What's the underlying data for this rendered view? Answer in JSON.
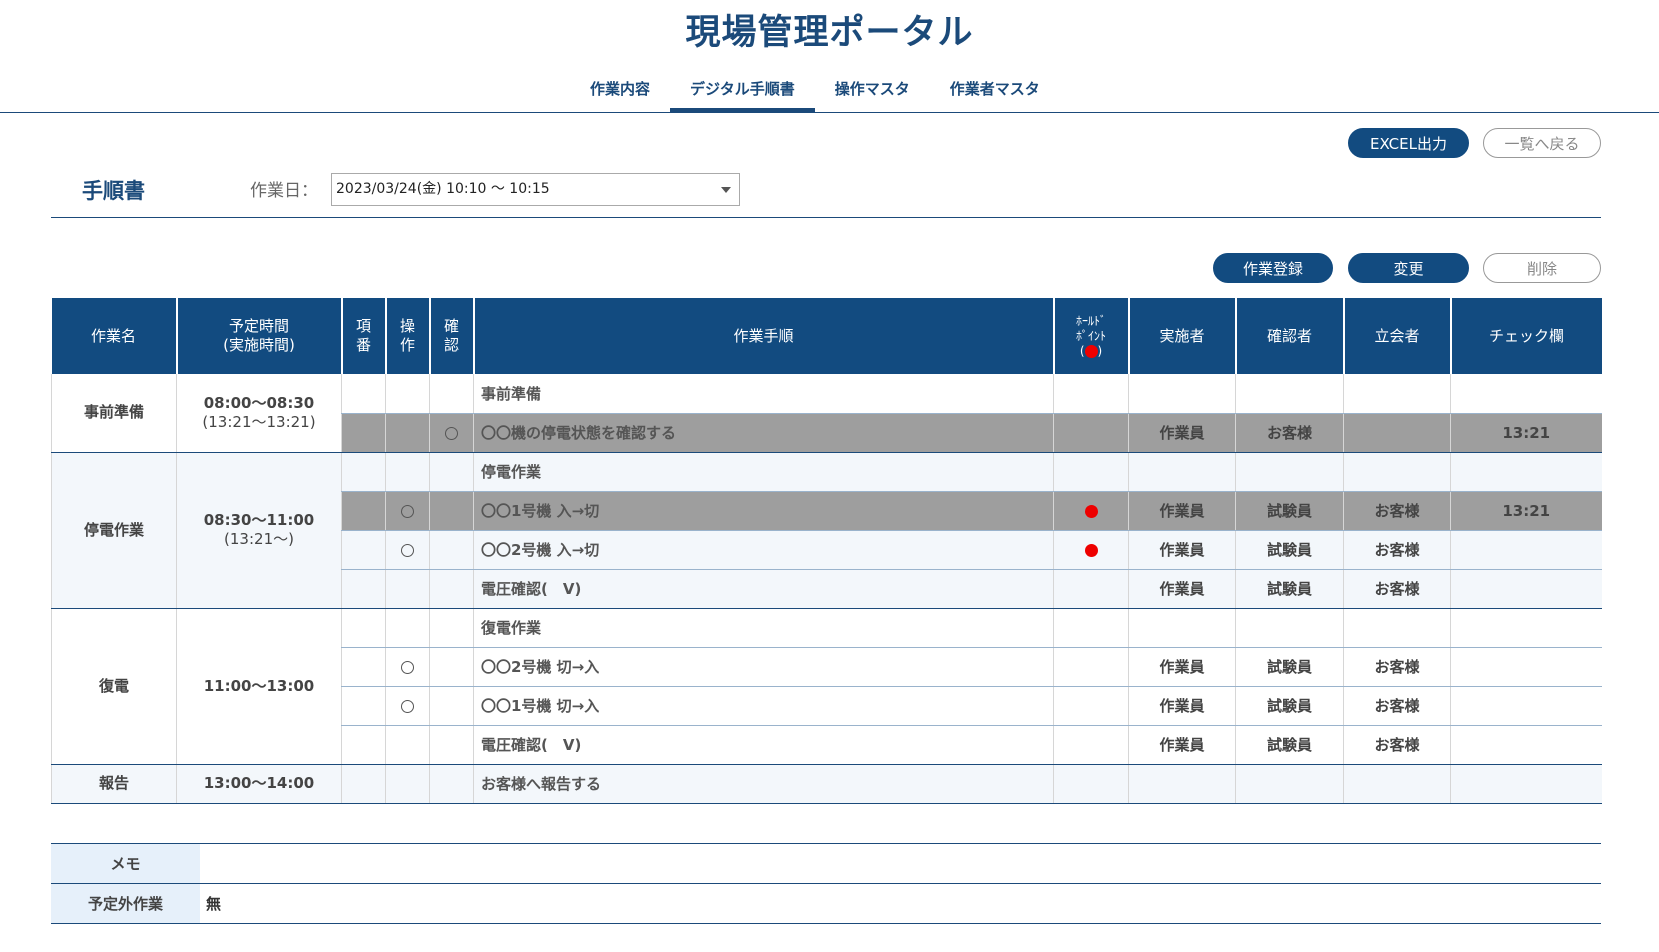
{
  "app": {
    "title": "現場管理ポータル"
  },
  "nav": {
    "tabs": [
      {
        "label": "作業内容",
        "active": false
      },
      {
        "label": "デジタル手順書",
        "active": true
      },
      {
        "label": "操作マスタ",
        "active": false
      },
      {
        "label": "作業者マスタ",
        "active": false
      }
    ]
  },
  "toolbar": {
    "excel_label": "EXCEL出力",
    "back_label": "一覧へ戻る"
  },
  "header": {
    "section_title": "手順書",
    "date_label": "作業日：",
    "date_value": "2023/03/24(金) 10:10 〜 10:15"
  },
  "actions": {
    "register_label": "作業登録",
    "change_label": "変更",
    "delete_label": "削除"
  },
  "table": {
    "headers": {
      "task_name": "作業名",
      "schedule_1": "予定時間",
      "schedule_2": "(実施時間)",
      "item_1": "項",
      "item_2": "番",
      "op_1": "操",
      "op_2": "作",
      "confirm_1": "確",
      "confirm_2": "認",
      "procedure": "作業手順",
      "hold_1": "ﾎｰﾙﾄﾞ",
      "hold_2": "ﾎﾟｲﾝﾄ",
      "hold_3_open": "(",
      "hold_3_close": ")",
      "performer": "実施者",
      "checker": "確認者",
      "witness": "立会者",
      "check_col": "チェック欄"
    },
    "groups": [
      {
        "name": "事前準備",
        "time": "08:00〜08:30",
        "actual": "(13:21〜13:21)",
        "rows": [
          {
            "step": "事前準備",
            "op": false,
            "confirm": false,
            "hold": false,
            "performer": "",
            "checker": "",
            "witness": "",
            "check": "",
            "grey": false
          },
          {
            "step": "〇〇機の停電状態を確認する",
            "op": false,
            "confirm": true,
            "hold": false,
            "performer": "作業員",
            "checker": "お客様",
            "witness": "",
            "check": "13:21",
            "grey": true
          }
        ]
      },
      {
        "name": "停電作業",
        "time": "08:30〜11:00",
        "actual": "(13:21〜)",
        "rows": [
          {
            "step": "停電作業",
            "op": false,
            "confirm": false,
            "hold": false,
            "performer": "",
            "checker": "",
            "witness": "",
            "check": "",
            "grey": false
          },
          {
            "step": "〇〇1号機 入→切",
            "op": true,
            "confirm": false,
            "hold": true,
            "performer": "作業員",
            "checker": "試験員",
            "witness": "お客様",
            "check": "13:21",
            "grey": true
          },
          {
            "step": "〇〇2号機 入→切",
            "op": true,
            "confirm": false,
            "hold": true,
            "performer": "作業員",
            "checker": "試験員",
            "witness": "お客様",
            "check": "",
            "grey": false
          },
          {
            "step": "電圧確認(　V)",
            "op": false,
            "confirm": false,
            "hold": false,
            "performer": "作業員",
            "checker": "試験員",
            "witness": "お客様",
            "check": "",
            "grey": false
          }
        ]
      },
      {
        "name": "復電",
        "time": "11:00〜13:00",
        "actual": "",
        "rows": [
          {
            "step": "復電作業",
            "op": false,
            "confirm": false,
            "hold": false,
            "performer": "",
            "checker": "",
            "witness": "",
            "check": "",
            "grey": false
          },
          {
            "step": "〇〇2号機 切→入",
            "op": true,
            "confirm": false,
            "hold": false,
            "performer": "作業員",
            "checker": "試験員",
            "witness": "お客様",
            "check": "",
            "grey": false
          },
          {
            "step": "〇〇1号機 切→入",
            "op": true,
            "confirm": false,
            "hold": false,
            "performer": "作業員",
            "checker": "試験員",
            "witness": "お客様",
            "check": "",
            "grey": false
          },
          {
            "step": "電圧確認(　V)",
            "op": false,
            "confirm": false,
            "hold": false,
            "performer": "作業員",
            "checker": "試験員",
            "witness": "お客様",
            "check": "",
            "grey": false
          }
        ]
      },
      {
        "name": "報告",
        "time": "13:00〜14:00",
        "actual": "",
        "rows": [
          {
            "step": "お客様へ報告する",
            "op": false,
            "confirm": false,
            "hold": false,
            "performer": "",
            "checker": "",
            "witness": "",
            "check": "",
            "grey": false
          }
        ]
      }
    ]
  },
  "memo": {
    "memo_label": "メモ",
    "memo_value": "",
    "unplanned_label": "予定外作業",
    "unplanned_value": "無"
  }
}
